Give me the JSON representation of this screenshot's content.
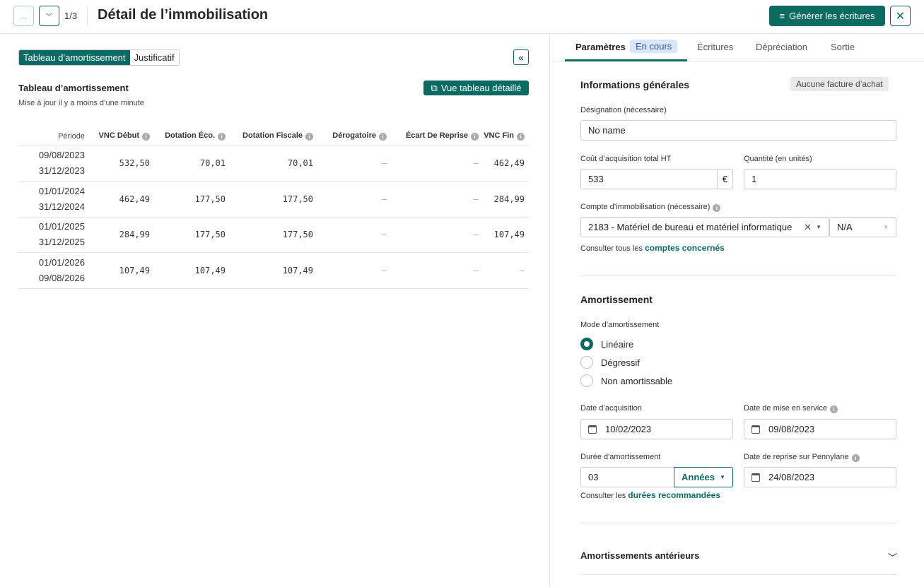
{
  "header": {
    "counter": "1/3",
    "title": "Détail de l’immobilisation",
    "generate_label": "Générer les écritures"
  },
  "left": {
    "seg_tabs": [
      "Tableau d’amortissement",
      "Justificatif"
    ],
    "title": "Tableau d’amortissement",
    "subtitle": "Mise à jour il y a moins d’une minute",
    "detail_button": "Vue tableau détaillé",
    "columns": [
      "Période",
      "VNC Début",
      "Dotation Éco.",
      "Dotation Fiscale",
      "Dérogatoire",
      "Écart De Reprise",
      "VNC Fin"
    ],
    "rows": [
      {
        "start": "09/08/2023",
        "end": "31/12/2023",
        "vnc_debut": "532,50",
        "dot_eco": "70,01",
        "dot_fisc": "70,01",
        "derog": "–",
        "ecart": "–",
        "vnc_fin": "462,49"
      },
      {
        "start": "01/01/2024",
        "end": "31/12/2024",
        "vnc_debut": "462,49",
        "dot_eco": "177,50",
        "dot_fisc": "177,50",
        "derog": "–",
        "ecart": "–",
        "vnc_fin": "284,99"
      },
      {
        "start": "01/01/2025",
        "end": "31/12/2025",
        "vnc_debut": "284,99",
        "dot_eco": "177,50",
        "dot_fisc": "177,50",
        "derog": "–",
        "ecart": "–",
        "vnc_fin": "107,49"
      },
      {
        "start": "01/01/2026",
        "end": "09/08/2026",
        "vnc_debut": "107,49",
        "dot_eco": "107,49",
        "dot_fisc": "107,49",
        "derog": "–",
        "ecart": "–",
        "vnc_fin": "–"
      }
    ]
  },
  "right": {
    "tabs": [
      "Paramètres",
      "Écritures",
      "Dépréciation",
      "Sortie"
    ],
    "status_badge": "En cours",
    "general": {
      "title": "Informations générales",
      "invoice_badge": "Aucune facture d’achat",
      "designation_label": "Désignation (nécessaire)",
      "designation": "No name",
      "cost_label": "Coût d’acquisition total HT",
      "cost": "533",
      "currency": "€",
      "qty_label": "Quantité (en unités)",
      "qty": "1",
      "account_label": "Compte d’immobilisation (nécessaire)",
      "account": "2183 - Matériel de bureau et matériel informatique",
      "analytic": "N/A",
      "consult_prefix": "Consulter tous les ",
      "consult_link": "comptes concernés"
    },
    "amort": {
      "title": "Amortissement",
      "mode_label": "Mode d’amortissement",
      "modes": [
        "Linéaire",
        "Dégressif",
        "Non amortissable"
      ],
      "selected_mode": "Linéaire",
      "acq_date_label": "Date d’acquisition",
      "acq_date": "10/02/2023",
      "service_date_label": "Date de mise en service",
      "service_date": "09/08/2023",
      "duration_label": "Durée d'amortissement",
      "duration": "03",
      "unit": "Années",
      "reprise_label": "Date de reprise sur Pennylane",
      "reprise_date": "24/08/2023",
      "consult_prefix": "Consulter les ",
      "consult_link": "durées recommandées"
    },
    "prior": {
      "title": "Amortissements antérieurs"
    }
  },
  "colors": {
    "accent": "#0b6b63",
    "badge_bg": "#d7e6fb"
  }
}
